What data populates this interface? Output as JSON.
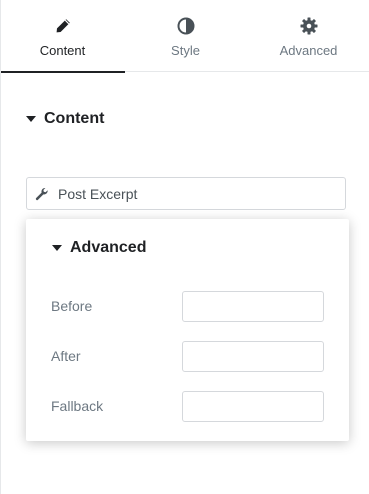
{
  "tabs": [
    {
      "label": "Content",
      "icon": "pencil-icon",
      "active": true
    },
    {
      "label": "Style",
      "icon": "half-circle-icon",
      "active": false
    },
    {
      "label": "Advanced",
      "icon": "gear-icon",
      "active": false
    }
  ],
  "section": {
    "title": "Content",
    "expanded": true
  },
  "dynamic_tag": {
    "label": "Post Excerpt",
    "icon": "wrench-icon"
  },
  "popover": {
    "title": "Advanced",
    "fields": [
      {
        "label": "Before",
        "value": "",
        "placeholder": ""
      },
      {
        "label": "After",
        "value": "",
        "placeholder": ""
      },
      {
        "label": "Fallback",
        "value": "",
        "placeholder": ""
      }
    ]
  },
  "colors": {
    "text_dark": "#1f2124",
    "text_muted": "#6d7882",
    "border": "#d5d8dc",
    "active_underline": "#1f2124"
  }
}
